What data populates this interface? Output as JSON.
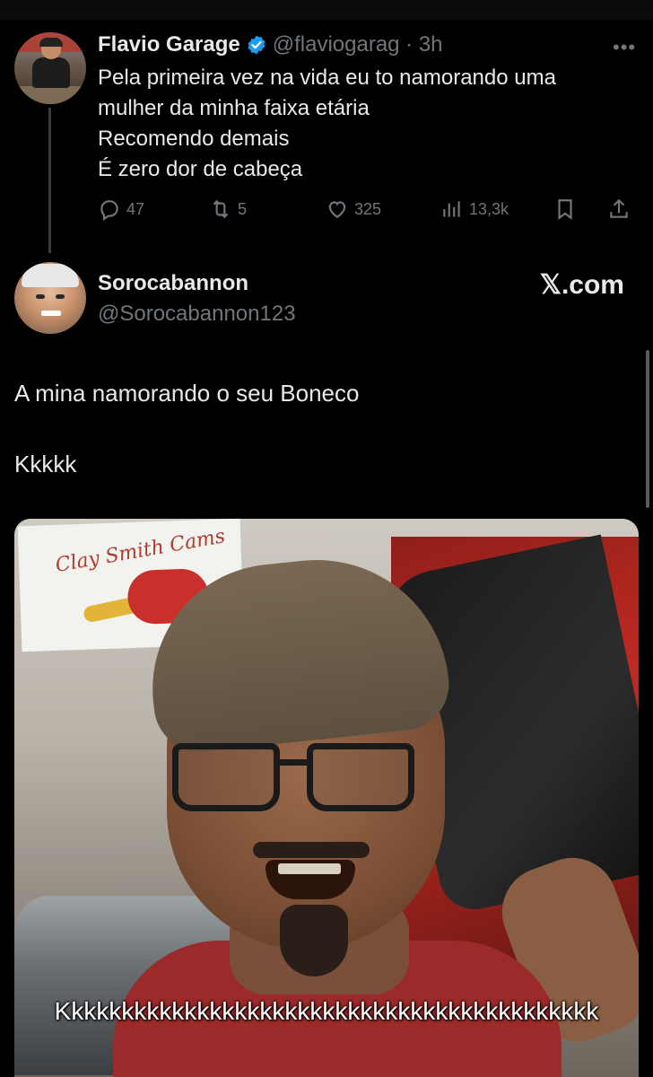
{
  "parent_tweet": {
    "author_name": "Flavio Garage",
    "handle_time": "@flaviogarag · 3h",
    "text_lines": [
      "Pela primeira vez na vida eu to namorando uma",
      "mulher da minha faixa etária",
      "Recomendo demais",
      "É zero dor de cabeça"
    ],
    "replies": "47",
    "retweets": "5",
    "likes": "325",
    "views": "13,3k",
    "more_icon": "more-horizontal-icon"
  },
  "quote_tweet": {
    "author_name": "Sorocabannon",
    "handle": "@Sorocabannon123",
    "site_label": "𝕏.com",
    "text_line1": "A mina namorando o seu Boneco",
    "text_line2": "Kkkkk"
  },
  "media": {
    "banner_text": "Clay Smith Cams",
    "caption": "Kkkkkkkkkkkkkkkkkkkkkkkkkkkkkkkkkkkkkkkkkkk"
  },
  "colors": {
    "background": "#000000",
    "text_primary": "#e7e9ea",
    "text_secondary": "#71767b",
    "verified_blue": "#1d9bf0"
  }
}
